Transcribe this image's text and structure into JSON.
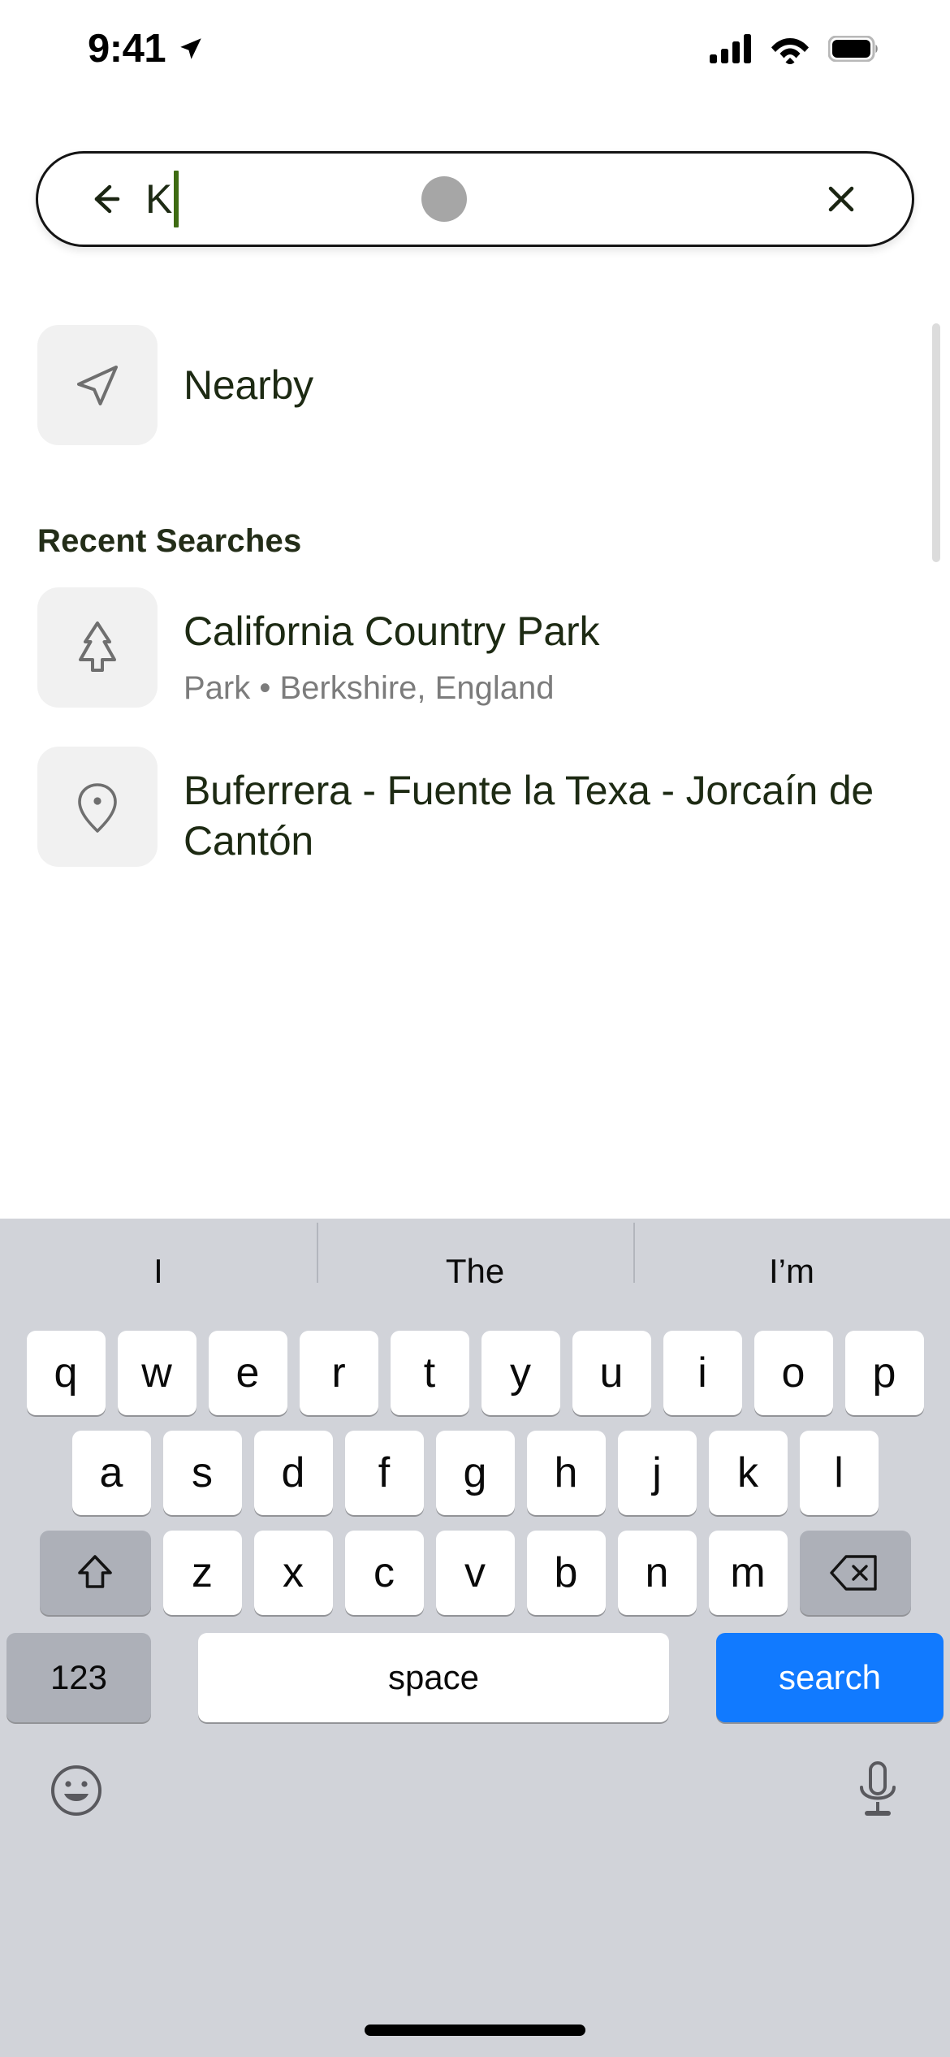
{
  "status_bar": {
    "time": "9:41",
    "location_icon": "location-arrow-icon",
    "cellular_icon": "cellular-signal-icon",
    "wifi_icon": "wifi-icon",
    "battery_icon": "battery-full-icon"
  },
  "search_bar": {
    "back_icon": "arrow-left-icon",
    "query_text": "K",
    "caret_color": "#3e6b12",
    "avatar_icon": "avatar-circle",
    "clear_icon": "close-x-icon"
  },
  "results": {
    "nearby": {
      "label": "Nearby",
      "icon": "navigation-arrow-icon"
    },
    "section_heading": "Recent Searches",
    "recent_searches": [
      {
        "title": "California Country Park",
        "subtitle": "Park • Berkshire, England",
        "icon": "pine-tree-icon"
      },
      {
        "title": "Buferrera - Fuente la Texa - Jorcaín de Cantón",
        "subtitle": "",
        "icon": "map-pin-icon"
      }
    ]
  },
  "keyboard": {
    "suggestions": [
      "I",
      "The",
      "I’m"
    ],
    "row1": [
      "q",
      "w",
      "e",
      "r",
      "t",
      "y",
      "u",
      "i",
      "o",
      "p"
    ],
    "row2": [
      "a",
      "s",
      "d",
      "f",
      "g",
      "h",
      "j",
      "k",
      "l"
    ],
    "row3": [
      "z",
      "x",
      "c",
      "v",
      "b",
      "n",
      "m"
    ],
    "shift_icon": "shift-arrow-icon",
    "backspace_icon": "backspace-delete-icon",
    "numbers_key": "123",
    "space_key": "space",
    "return_key": "search",
    "return_key_color": "#117aff",
    "emoji_icon": "emoji-smiley-icon",
    "dictation_icon": "microphone-icon"
  }
}
